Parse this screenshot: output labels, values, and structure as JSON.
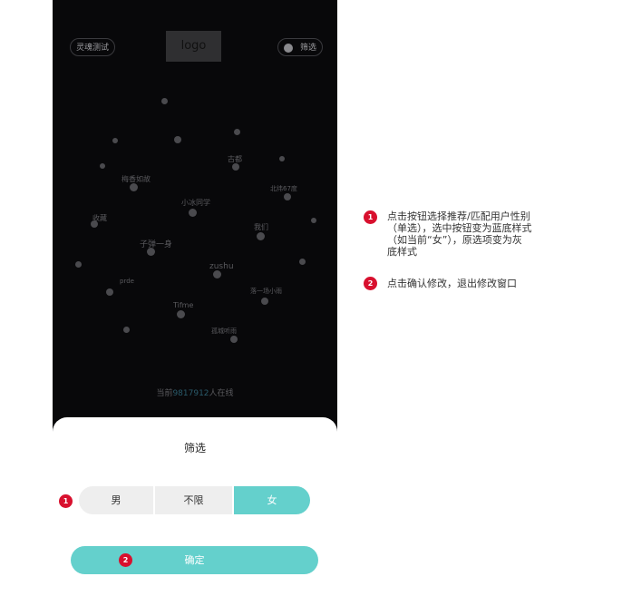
{
  "header": {
    "left_button_label": "灵魂测试",
    "logo_text": "logo",
    "filter_button_label": "筛选"
  },
  "cloud": {
    "labels": [
      "子弹一身",
      "zushu",
      "Tifme",
      "小冰同学",
      "古都",
      "我们",
      "梅香如故",
      "收藏",
      "prde",
      "落一场小雨",
      "北纬67度",
      "孤城听雨"
    ]
  },
  "online": {
    "prefix": "当前",
    "count": "9817912",
    "suffix": "人在线"
  },
  "sheet": {
    "title": "筛选",
    "options": {
      "male": "男",
      "any": "不限",
      "female": "女"
    },
    "selected": "女",
    "confirm_label": "确定"
  },
  "annotations": {
    "marker1": "1",
    "marker2": "2",
    "note1_lines": [
      "点击按钮选择推荐/匹配用户性别",
      "（单选），选中按钮变为蓝底样式",
      "（如当前“女”），原选项变为灰",
      "底样式"
    ],
    "note2": "点击确认修改，退出修改窗口"
  },
  "colors": {
    "accent": "#64d0cc",
    "marker": "#d8102e",
    "phone_bg": "#08080a",
    "segment_unselected": "#eeeeee"
  }
}
